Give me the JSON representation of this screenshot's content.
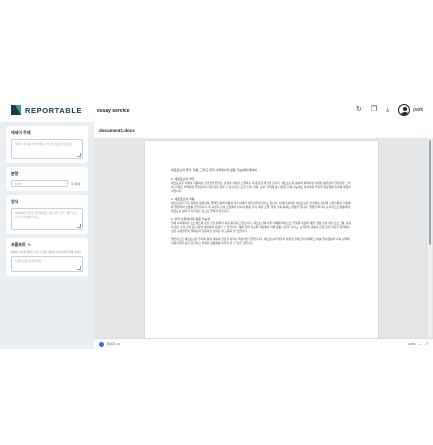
{
  "header": {
    "brand": "REPORTABLE",
    "service_title": "essay service",
    "user_name": "park",
    "icons": [
      "refresh-icon",
      "document-icon",
      "download-icon",
      "user-avatar-icon"
    ]
  },
  "sidebar": {
    "essay_topic": {
      "title": "에세이 주제",
      "placeholder": "에세이 주제를 입력하세요. 예) 환경보호의 중요성"
    },
    "word_count": {
      "title": "분량",
      "placeholder": "1000",
      "unit": "자 이내"
    },
    "outline": {
      "title": "양식",
      "placeholder": "에세이의 양식을 입력하세요. 예) 서론, 본론, 결론으로 나누어 작성해주세요."
    },
    "prompt": {
      "title": "프롬프트",
      "helper": "에세이 작성을 위해 추가로 요청할 내용을 자유롭게 입력해 주세요.",
      "placeholder": "프롬프트를 입력하세요."
    }
  },
  "document": {
    "file_name": "document1.docx",
    "intro": "세로토닌의 역할, 작용, 그리고 우리 사회에서의 활용 가능성에 대하여",
    "sections": [
      {
        "title": "1. 세로토닌의 역할",
        "body": "세로토닌은 뇌에서 작용하는 신경전달물질로, 감정과 기분을 조절하는 데 중요한 역할을 합니다. 세로토닌이 충분히 분비되면 사람은 평온함과 안정감을 느끼며, 반대로 부족하면 우울감이나 불안감을 겪을 수 있습니다. 또한 수면, 식욕, 소화, 기억력 등 다양한 신체 기능에도 관여하여 우리의 일상생활 전반에 영향을 미칩니다."
      },
      {
        "title": "2. 세로토닌의 작용",
        "body": "세로토닌은 주로 장에서 생성되며, 혈액을 통해 이동하거나 뇌에서 직접 만들어지기도 합니다. 뇌에서 분비된 세로토닌은 신경세포 사이의 시냅스에서 수용체와 결합하여 신호를 전달합니다. 이 과정은 감정 조절뿐만 아니라 통증 인식, 체온 조절, 혈관 수축 등에도 영향을 줍니다. 햇빛을 쬐거나 규칙적으로 운동하면 세로토닌 분비가 촉진되는 것으로 알려져 있습니다."
      },
      {
        "title": "3. 우리 사회에서의 활용 가능성",
        "body": "현대 사회에서는 스트레스와 정신 건강 문제가 점점 증가하고 있습니다. 세로토닌에 대한 이해를 바탕으로 우울증 치료제 개발, 생활 습관 개선 프로그램, 직장 내 정신 건강 관리 등 다양한 분야에서 활용할 수 있습니다. 예를 들어 학교와 직장에서 야외 활동 시간을 늘리고, 규칙적인 운동과 균형 잡힌 식단을 장려하는 것은 구성원들의 행복감과 집중력을 높이는 데 도움이 될 것입니다."
      },
      {
        "title": "",
        "body": "결론적으로 세로토닌은 우리의 몸과 마음의 건강을 지키는 핵심적인 물질입니다. 세로토닌의 역할과 작용을 올바르게 이해하고 이를 일상생활과 사회 정책에 적용한다면 보다 건강하고 행복한 공동체를 만들어 갈 수 있을 것입니다."
      }
    ]
  },
  "statusbar": {
    "page": "페이지 1/1",
    "zoom": "100%",
    "fit_icon": "fit-width-icon",
    "fullscreen_icon": "fullscreen-icon"
  }
}
